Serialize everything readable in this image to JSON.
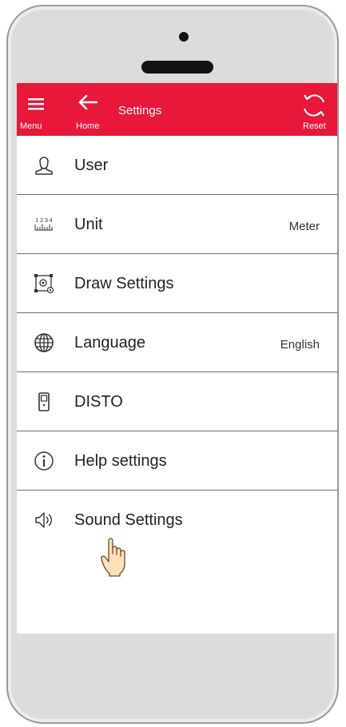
{
  "header": {
    "menu_label": "Menu",
    "home_label": "Home",
    "title": "Settings",
    "reset_label": "Reset",
    "bar_color": "#e8183a"
  },
  "settings": [
    {
      "label": "User",
      "value": "",
      "icon": "user-icon"
    },
    {
      "label": "Unit",
      "value": "Meter",
      "icon": "ruler-icon"
    },
    {
      "label": "Draw Settings",
      "value": "",
      "icon": "draw-settings-icon"
    },
    {
      "label": "Language",
      "value": "English",
      "icon": "globe-icon"
    },
    {
      "label": "DISTO",
      "value": "",
      "icon": "disto-device-icon"
    },
    {
      "label": "Help settings",
      "value": "",
      "icon": "info-icon"
    },
    {
      "label": "Sound Settings",
      "value": "",
      "icon": "speaker-icon"
    }
  ],
  "unit_icon_digits": "1 2 3 4"
}
